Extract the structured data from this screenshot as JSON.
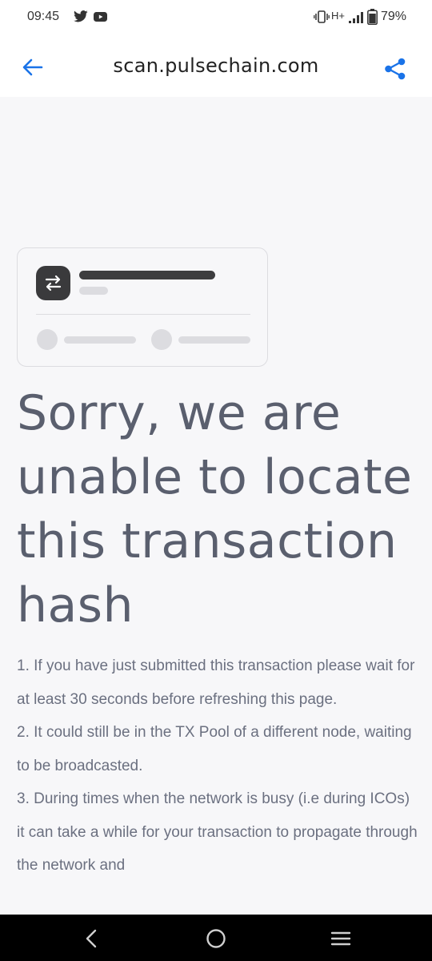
{
  "status_bar": {
    "time": "09:45",
    "network": "H+",
    "battery": "79%",
    "icons": [
      "twitter-icon",
      "youtube-icon",
      "vibrate-icon",
      "signal-icon",
      "battery-icon"
    ]
  },
  "browser": {
    "url_title": "scan.pulsechain.com",
    "icons": [
      "back-arrow-icon",
      "share-icon"
    ],
    "accent_color": "#1a73e8"
  },
  "error": {
    "heading": "Sorry, we are unable to locate this transaction hash",
    "items": [
      "1. If you have just submitted this transaction please wait for at least 30 seconds before refreshing this page.",
      "2. It could still be in the TX Pool of a different node, waiting to be broadcasted.",
      "3. During times when the network is busy (i.e during ICOs) it can take a while for your transaction to propagate through the network and"
    ]
  },
  "illustration": {
    "icon": "swap-arrows-icon"
  },
  "nav_bar": {
    "icons": [
      "nav-back-icon",
      "nav-home-icon",
      "nav-recents-icon"
    ]
  },
  "colors": {
    "page_background": "#f7f7f9",
    "heading_text": "#5a5f6e",
    "body_text": "#6b7080"
  }
}
